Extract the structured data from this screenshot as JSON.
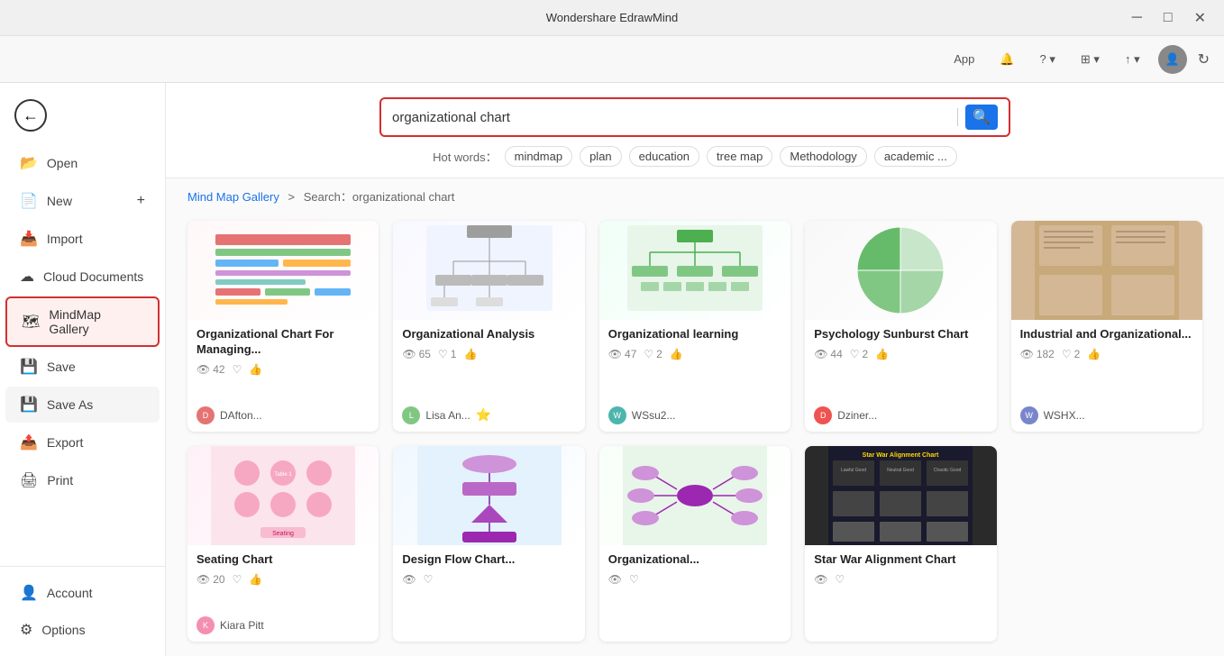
{
  "app": {
    "title": "Wondershare EdrawMind"
  },
  "titlebar": {
    "minimize": "─",
    "maximize": "□",
    "close": "✕"
  },
  "toolbar": {
    "app_label": "App",
    "notification_icon": "🔔",
    "help_label": "?",
    "grid_icon": "⊞",
    "share_icon": "↑"
  },
  "sidebar": {
    "back_icon": "←",
    "items": [
      {
        "id": "open",
        "icon": "📂",
        "label": "Open"
      },
      {
        "id": "new",
        "icon": "📄",
        "label": "New",
        "has_plus": true
      },
      {
        "id": "import",
        "icon": "📥",
        "label": "Import"
      },
      {
        "id": "cloud",
        "icon": "☁",
        "label": "Cloud Documents"
      },
      {
        "id": "mindmap-gallery",
        "icon": "🗺",
        "label": "MindMap Gallery",
        "active": true
      },
      {
        "id": "save",
        "icon": "💾",
        "label": "Save"
      },
      {
        "id": "save-as",
        "icon": "💾",
        "label": "Save As"
      },
      {
        "id": "export",
        "icon": "📤",
        "label": "Export"
      },
      {
        "id": "print",
        "icon": "🖨",
        "label": "Print"
      }
    ],
    "bottom_items": [
      {
        "id": "account",
        "icon": "👤",
        "label": "Account"
      },
      {
        "id": "options",
        "icon": "⚙",
        "label": "Options"
      }
    ]
  },
  "search": {
    "placeholder": "organizational chart",
    "search_icon": "🔍",
    "hot_label": "Hot words：",
    "hot_tags": [
      "mindmap",
      "plan",
      "education",
      "tree map",
      "Methodology",
      "academic ..."
    ]
  },
  "breadcrumb": {
    "gallery_link": "Mind Map Gallery",
    "separator": ">",
    "current": "Search：organizational chart"
  },
  "gallery": {
    "cards": [
      {
        "id": "org-chart-managing",
        "title": "Organizational Chart For Managing...",
        "views": "42",
        "likes": "",
        "shares": "",
        "author": "DAfton...",
        "author_color": "#e57373",
        "thumbnail_type": "org-chart"
      },
      {
        "id": "org-analysis",
        "title": "Organizational Analysis",
        "views": "65",
        "likes": "1",
        "shares": "",
        "author": "Lisa An...",
        "author_color": "#81c784",
        "is_premium": true,
        "thumbnail_type": "org-analysis"
      },
      {
        "id": "org-learning",
        "title": "Organizational learning",
        "views": "47",
        "likes": "2",
        "shares": "",
        "author": "WSsu2...",
        "author_color": "#4db6ac",
        "thumbnail_type": "org-learning"
      },
      {
        "id": "psych-sunburst",
        "title": "Psychology Sunburst Chart",
        "views": "44",
        "likes": "2",
        "shares": "",
        "author": "Dziner...",
        "author_color": "#ef5350",
        "thumbnail_type": "sunburst"
      },
      {
        "id": "industrial-org",
        "title": "Industrial and Organizational...",
        "views": "182",
        "likes": "2",
        "shares": "",
        "author": "WSHX...",
        "author_color": "#7986cb",
        "thumbnail_type": "industrial"
      },
      {
        "id": "seating-chart",
        "title": "Seating Chart",
        "views": "20",
        "likes": "",
        "shares": "",
        "author": "Kiara Pitt",
        "author_color": "#f48fb1",
        "thumbnail_type": "seating"
      },
      {
        "id": "design-flow-chart",
        "title": "Design Flow Chart...",
        "views": "",
        "likes": "",
        "shares": "",
        "author": "",
        "thumbnail_type": "design-flow"
      },
      {
        "id": "org2",
        "title": "Organizational...",
        "views": "",
        "likes": "",
        "shares": "",
        "author": "",
        "thumbnail_type": "org2"
      },
      {
        "id": "star-wars",
        "title": "Star War Alignment Chart",
        "views": "",
        "likes": "",
        "shares": "",
        "author": "",
        "thumbnail_type": "star-wars"
      }
    ]
  }
}
